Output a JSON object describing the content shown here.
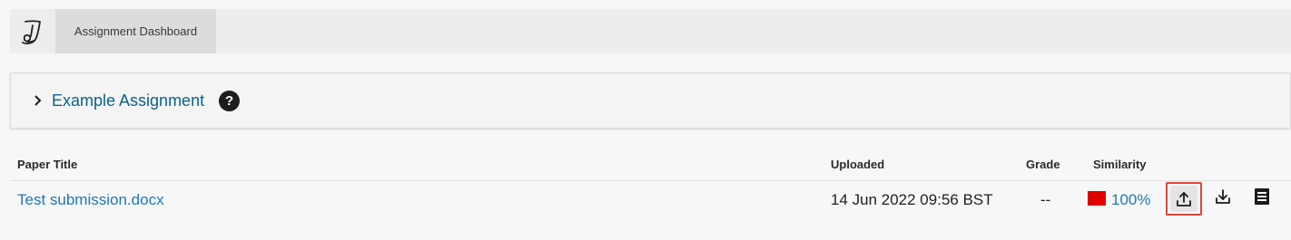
{
  "header": {
    "logo_icon": "turnitin-logo-icon",
    "tab_label": "Assignment Dashboard"
  },
  "assignment": {
    "title": "Example Assignment",
    "help_label": "?",
    "expand_icon": "chevron-right-icon"
  },
  "table": {
    "headers": {
      "paper_title": "Paper Title",
      "uploaded": "Uploaded",
      "grade": "Grade",
      "similarity": "Similarity"
    },
    "rows": [
      {
        "paper_title": "Test submission.docx",
        "uploaded": "14 Jun 2022 09:56 BST",
        "grade": "--",
        "similarity": "100%",
        "similarity_color": "#e00000"
      }
    ]
  },
  "colors": {
    "link": "#1f78b4",
    "assignment_link": "#0b6386",
    "highlight": "#e0453a"
  },
  "actions": [
    "upload-icon",
    "download-icon",
    "document-icon"
  ]
}
